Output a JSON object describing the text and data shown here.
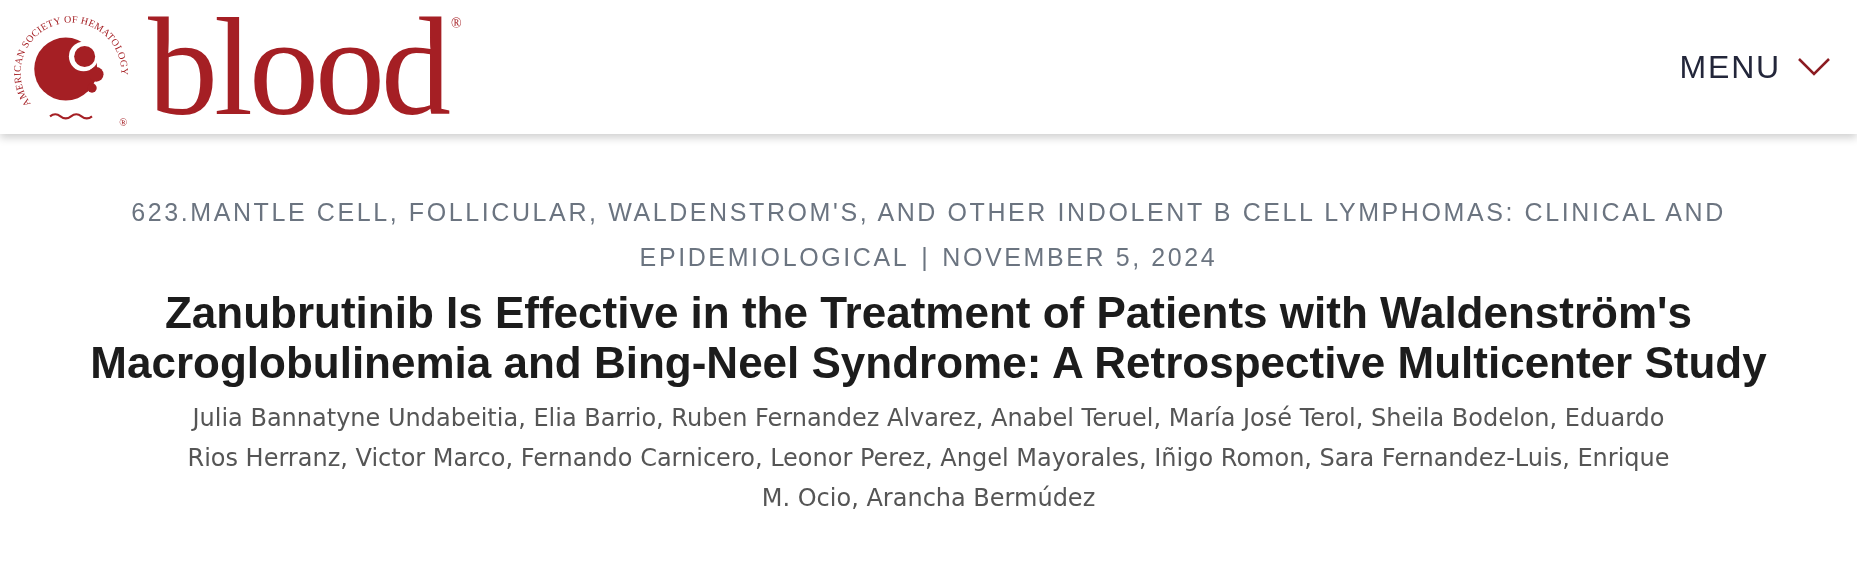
{
  "header": {
    "logo": {
      "ring_text": "AMERICAN SOCIETY OF HEMATOLOGY",
      "ring_mark": "®",
      "wordmark": "blood",
      "wordmark_mark": "®"
    },
    "menu": {
      "label": "MENU",
      "expanded": false
    }
  },
  "article": {
    "category": "623.MANTLE CELL, FOLLICULAR, WALDENSTROM'S, AND OTHER INDOLENT B CELL LYMPHOMAS: CLINICAL AND EPIDEMIOLOGICAL",
    "separator": "|",
    "date": "NOVEMBER 5, 2024",
    "title": "Zanubrutinib Is Effective in the Treatment of Patients with Waldenström's Macroglobulinemia and Bing-Neel Syndrome: A Retrospective Multicenter Study",
    "authors": "Julia Bannatyne Undabeitia, Elia Barrio, Ruben Fernandez Alvarez, Anabel Teruel, María José Terol, Sheila Bodelon, Eduardo Rios Herranz, Victor Marco, Fernando Carnicero, Leonor Perez, Angel Mayorales, Iñigo Romon, Sara Fernandez-Luis, Enrique M. Ocio, Arancha Bermúdez"
  }
}
